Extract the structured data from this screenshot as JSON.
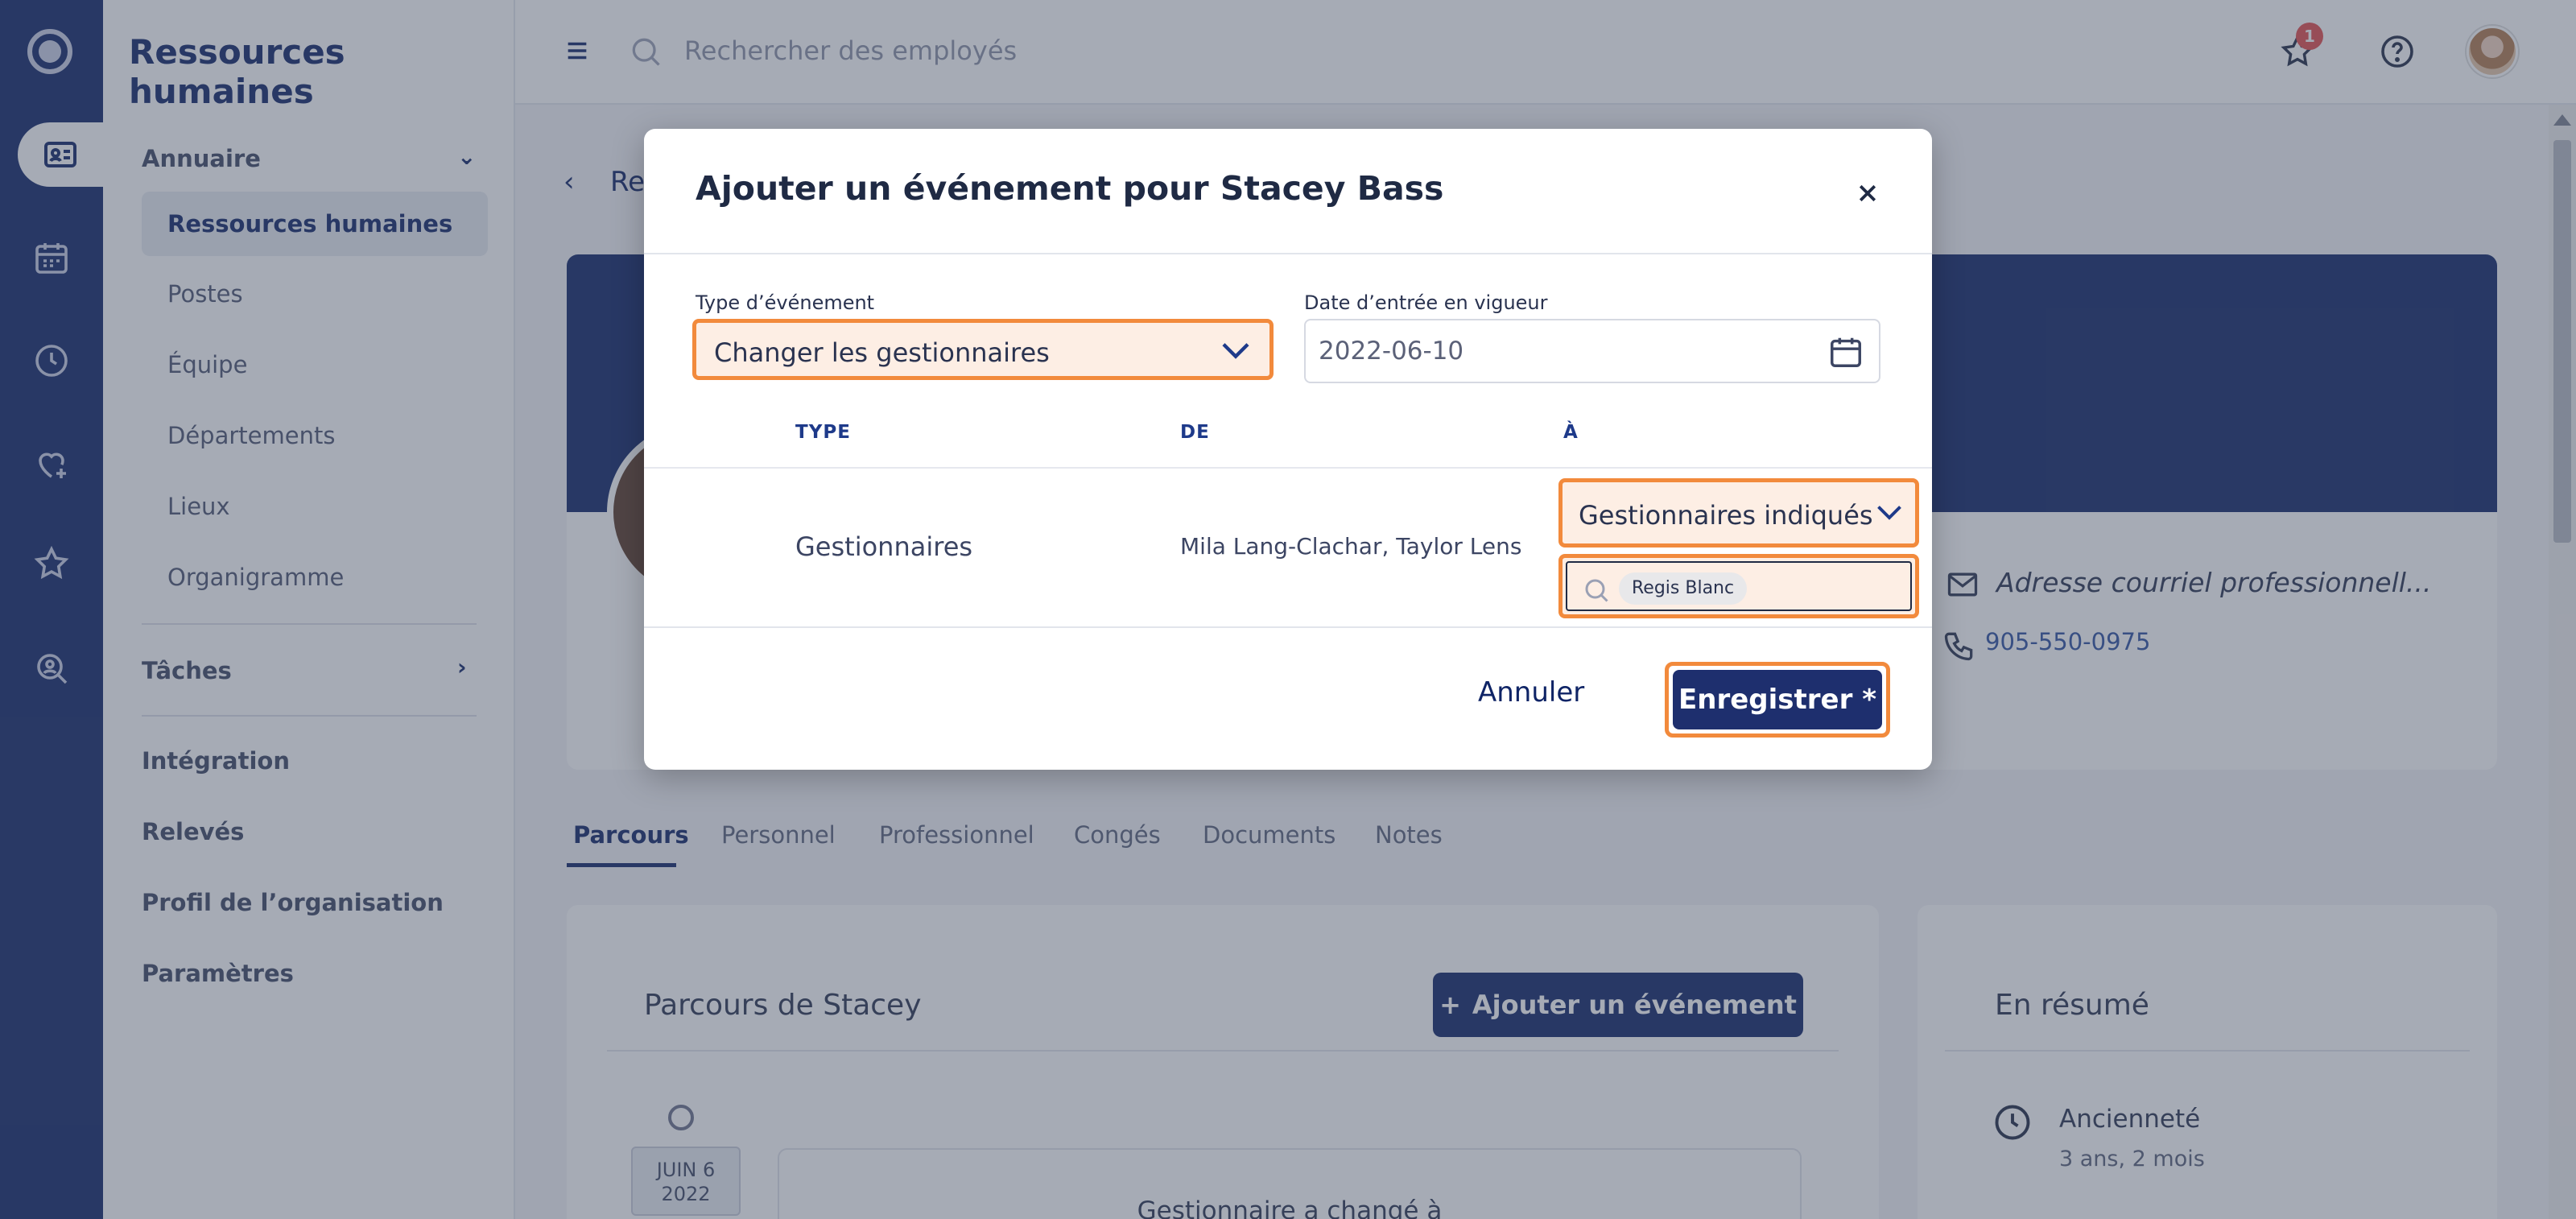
{
  "sidebar": {
    "title": "Ressources humaines",
    "sections": [
      {
        "label": "Annuaire"
      },
      {
        "label": "Tâches"
      },
      {
        "label": "Intégration"
      },
      {
        "label": "Relevés"
      },
      {
        "label": "Profil de l’organisation"
      },
      {
        "label": "Paramètres"
      }
    ],
    "directory_items": [
      {
        "label": "Ressources humaines"
      },
      {
        "label": "Postes"
      },
      {
        "label": "Équipe"
      },
      {
        "label": "Départements"
      },
      {
        "label": "Lieux"
      },
      {
        "label": "Organigramme"
      }
    ]
  },
  "topbar": {
    "search_placeholder": "Rechercher des employés",
    "notification_count": "1"
  },
  "main": {
    "back_label": "Re",
    "email": "Adresse courriel professionnell...",
    "phone": "905-550-0975",
    "tabs": [
      {
        "label": "Parcours"
      },
      {
        "label": "Personnel"
      },
      {
        "label": "Professionnel"
      },
      {
        "label": "Congés"
      },
      {
        "label": "Documents"
      },
      {
        "label": "Notes"
      }
    ],
    "journey": {
      "title": "Parcours de Stacey",
      "add_button": "Ajouter un événement",
      "date_line1": "JUIN 6",
      "date_line2": "2022",
      "event_text": "Gestionnaire a changé à"
    },
    "summary": {
      "title": "En résumé",
      "seniority_label": "Ancienneté",
      "seniority_value": "3 ans, 2 mois"
    }
  },
  "modal": {
    "title": "Ajouter un événement pour Stacey Bass",
    "event_type_label": "Type d’événement",
    "event_type_value": "Changer les gestionnaires",
    "effective_date_label": "Date d’entrée en vigueur",
    "effective_date_value": "2022-06-10",
    "table": {
      "headers": [
        "TYPE",
        "DE",
        "À"
      ],
      "row": {
        "type": "Gestionnaires",
        "from": "Mila Lang-Clachar, Taylor Lens",
        "to_select": "Gestionnaires indiqués",
        "chip": "Regis Blanc"
      }
    },
    "cancel_label": "Annuler",
    "save_label": "Enregistrer *"
  },
  "colors": {
    "brand": "#0f2466",
    "highlight_border": "#f28a3c",
    "highlight_fill": "#fdeee4",
    "badge": "#e24c4c"
  }
}
